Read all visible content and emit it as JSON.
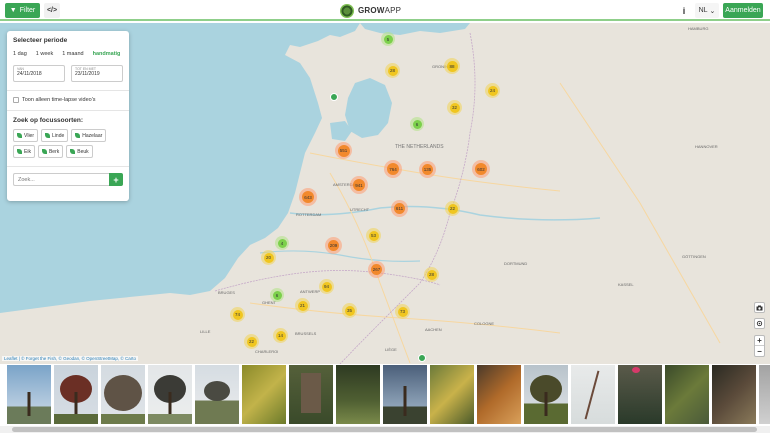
{
  "header": {
    "filter_label": "Filter",
    "code_label": "</>",
    "logo_bold": "GROW",
    "logo_light": "APP",
    "info_label": "i",
    "lang_label": "NL",
    "lang_arrow": "⌄",
    "login_label": "Aanmelden"
  },
  "panel": {
    "period_title": "Selecteer periode",
    "periods": [
      "1 dag",
      "1 week",
      "1 maand",
      "handmatig"
    ],
    "from_label": "VAN",
    "from_value": "24/11/2018",
    "to_label": "TOT EN MET",
    "to_value": "23/11/2019",
    "timelapse_label": "Toon alleen time-lapse video's",
    "species_title": "Zoek op focussoorten:",
    "species": [
      "Vlier",
      "Linde",
      "Hazelaar",
      "Eik",
      "Berk",
      "Beuk"
    ],
    "search_placeholder": "Zoek...",
    "add_label": "+"
  },
  "map": {
    "place_labels": [
      "THE NETHERLANDS",
      "AMSTERDAM",
      "UTRECHT",
      "ROTTERDAM",
      "ANTWERP",
      "BRUSSELS",
      "BRUGES",
      "GHENT",
      "GRONINGEN",
      "HAMBURG",
      "HANNOVER",
      "GÖTTINGEN",
      "KASSEL",
      "COLOGNE",
      "DORTMUND",
      "LIÈGE",
      "CHARLEROI",
      "LILLE",
      "AACHEN"
    ],
    "clusters": [
      "5",
      "28",
      "88",
      "24",
      "32",
      "6",
      "551",
      "764",
      "135",
      "602",
      "941",
      "643",
      "611",
      "22",
      "4",
      "209",
      "53",
      "20",
      "267",
      "28",
      "6",
      "94",
      "21",
      "74",
      "35",
      "73",
      "14",
      "22"
    ],
    "attribution_prefix": "Leaflet | © Forget the Fish, © Geodan, © OpenStreetMap, © Carto",
    "zoom_in": "+",
    "zoom_out": "−"
  },
  "colors": {
    "accent": "#3aa655",
    "cluster_small": "#f0c20c",
    "cluster_large": "#f18017",
    "cluster_tiny": "#6ecc39",
    "water": "#aad3df"
  },
  "thumbnails": {
    "count": 17,
    "subjects": [
      "bare-tree",
      "red-tree",
      "bushy-tree",
      "willow",
      "yard",
      "yellow-leaves",
      "shed",
      "hedge",
      "dusk-tree",
      "leaf-closeup",
      "autumn-branch",
      "oak",
      "white-branch",
      "berries",
      "plant",
      "purple-plant",
      "branch-partial"
    ]
  }
}
